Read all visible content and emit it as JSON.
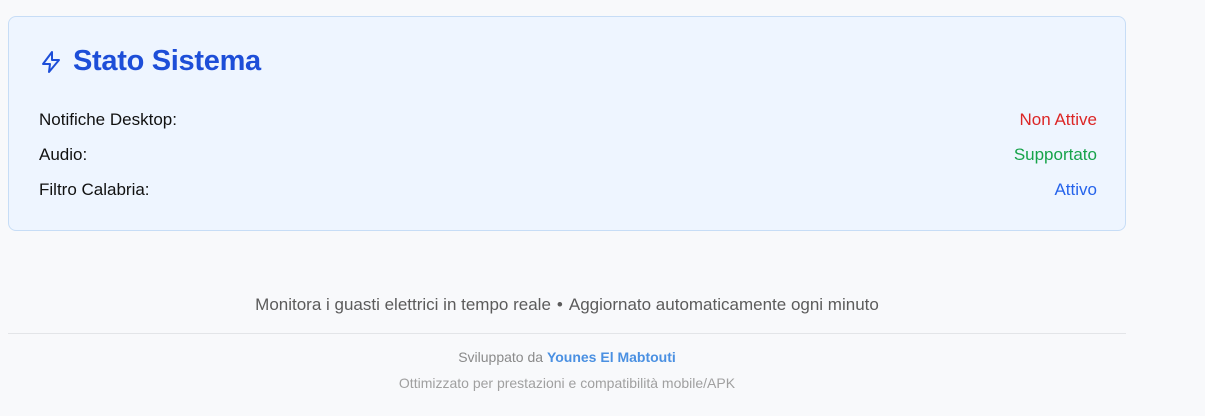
{
  "status_card": {
    "icon": "lightning-bolt-icon",
    "title": "Stato Sistema",
    "rows": [
      {
        "label": "Notifiche Desktop:",
        "value": "Non Attive",
        "color": "#dc2626"
      },
      {
        "label": "Audio:",
        "value": "Supportato",
        "color": "#16a34a"
      },
      {
        "label": "Filtro Calabria:",
        "value": "Attivo",
        "color": "#2563eb"
      }
    ]
  },
  "footer": {
    "info_left": "Monitora i guasti elettrici in tempo reale",
    "separator": "•",
    "info_right": "Aggiornato automaticamente ogni minuto",
    "developed_by": "Sviluppato da",
    "author": "Younes El Mabtouti",
    "optimized": "Ottimizzato per prestazioni e compatibilità mobile/APK"
  },
  "colors": {
    "accent": "#1d4ed8",
    "card_bg": "#eef5ff",
    "card_border": "#c7ddf6",
    "link": "#4a90e2"
  }
}
